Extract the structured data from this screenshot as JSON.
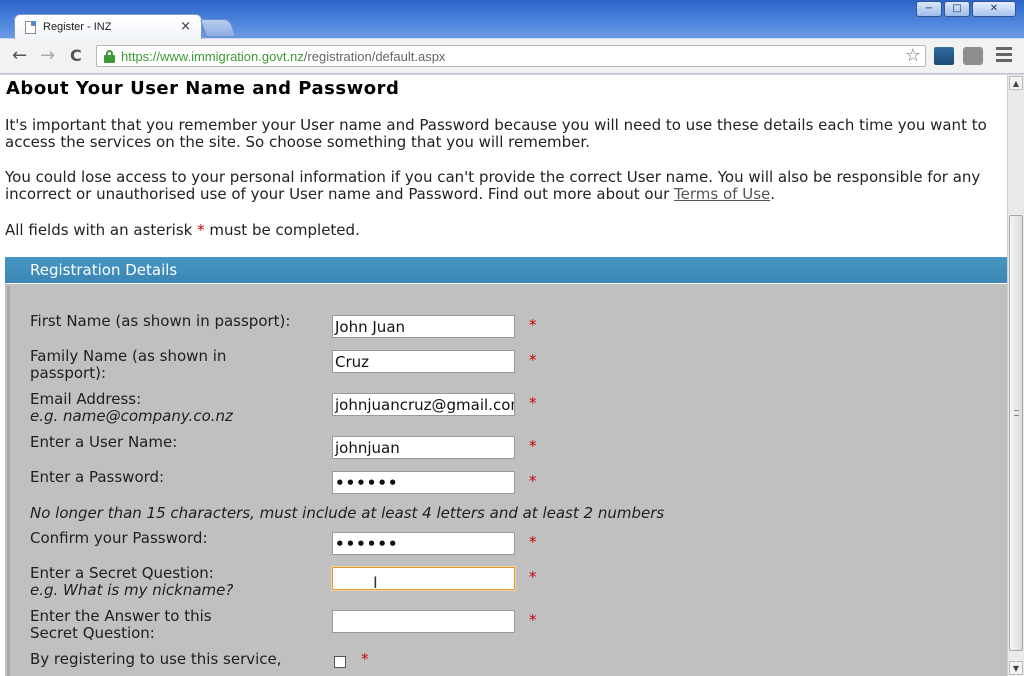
{
  "browser": {
    "tab_title": "Register - INZ",
    "tab_close": "×",
    "url_secure": "https://www.immigration.govt.nz",
    "url_path": "/registration/default.aspx",
    "window_controls": [
      "−",
      "□",
      "✕"
    ]
  },
  "nav": {
    "back_icon": "←",
    "forward_icon": "→",
    "reload_icon": "C",
    "bookmark_icon": "☆"
  },
  "page": {
    "heading": "About Your User Name and Password",
    "paragraph1": "It's important that you remember your User name and Password because you will need to use these details each time you want to access the services on the site. So choose something that you will remember.",
    "paragraph2_start": "You could lose access to your personal information if you can't provide the correct User name. You will also be responsible for any incorrect or unauthorised use of your User name and Password. Find out more about our ",
    "terms_link": "Terms of Use",
    "paragraph2_end": ".",
    "asterisk_note_start": "All fields with an asterisk ",
    "asterisk": "*",
    "asterisk_note_end": " must be completed."
  },
  "section": {
    "title": "Registration Details"
  },
  "form": {
    "first_name_label": "First Name (as shown in passport):",
    "first_name_value": "John Juan",
    "family_name_label_1": "Family Name (as shown in",
    "family_name_label_2": "passport):",
    "family_name_value": "Cruz",
    "email_label": "Email Address:",
    "email_hint": "e.g. name@company.co.nz",
    "email_value": "johnjuancruz@gmail.com",
    "username_label": "Enter a User Name:",
    "username_value": "johnjuan",
    "password_label": "Enter a Password:",
    "password_value": "••••••",
    "password_hint": "No longer than 15 characters, must include at least 4 letters and at least 2 numbers",
    "confirm_label": "Confirm your Password:",
    "confirm_value": "••••••",
    "secret_q_label": "Enter a Secret Question:",
    "secret_q_hint": "e.g. What is my nickname?",
    "secret_q_value": "",
    "secret_a_label_1": "Enter the Answer to this",
    "secret_a_label_2": "Secret Question:",
    "secret_a_value": "",
    "terms_label": "By registering to use this service,",
    "required_mark": "*"
  },
  "colors": {
    "section_bar": "#3b86b4",
    "form_bg": "#c0c0c0",
    "required": "#cc0000",
    "secure_url": "#3c9a36"
  }
}
